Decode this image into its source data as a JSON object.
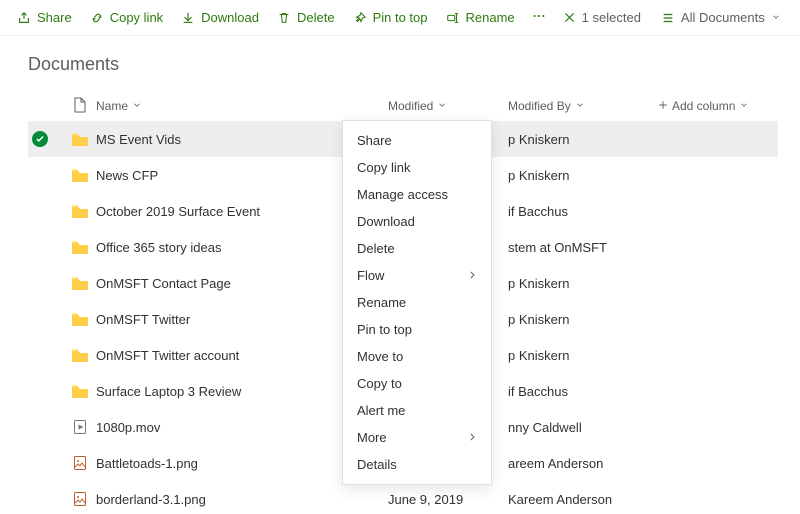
{
  "toolbar": {
    "share": "Share",
    "copy_link": "Copy link",
    "download": "Download",
    "delete": "Delete",
    "pin": "Pin to top",
    "rename": "Rename",
    "selected": "1 selected",
    "view": "All Documents"
  },
  "page": {
    "title": "Documents"
  },
  "columns": {
    "name": "Name",
    "modified": "Modified",
    "modified_by": "Modified By",
    "add": "Add column"
  },
  "rows": [
    {
      "type": "folder",
      "name": "MS Event Vids",
      "modified": "",
      "by": "p Kniskern",
      "selected": true
    },
    {
      "type": "folder",
      "name": "News CFP",
      "modified": "",
      "by": "p Kniskern"
    },
    {
      "type": "folder",
      "name": "October 2019 Surface Event",
      "modified": "",
      "by": "if Bacchus"
    },
    {
      "type": "folder",
      "name": "Office 365 story ideas",
      "modified": "",
      "by": "stem at OnMSFT"
    },
    {
      "type": "folder",
      "name": "OnMSFT Contact Page",
      "modified": "",
      "by": "p Kniskern"
    },
    {
      "type": "folder",
      "name": "OnMSFT Twitter",
      "modified": "",
      "by": "p Kniskern"
    },
    {
      "type": "folder",
      "name": "OnMSFT Twitter account",
      "modified": "",
      "by": "p Kniskern"
    },
    {
      "type": "folder",
      "name": "Surface Laptop 3 Review",
      "modified": "",
      "by": "if Bacchus"
    },
    {
      "type": "video",
      "name": "1080p.mov",
      "modified": "",
      "by": "nny Caldwell"
    },
    {
      "type": "image",
      "name": "Battletoads-1.png",
      "modified": "",
      "by": "areem Anderson"
    },
    {
      "type": "image",
      "name": "borderland-3.1.png",
      "modified": "June 9, 2019",
      "by": "Kareem Anderson"
    }
  ],
  "ctx": {
    "items": [
      {
        "label": "Share"
      },
      {
        "label": "Copy link"
      },
      {
        "label": "Manage access"
      },
      {
        "label": "Download"
      },
      {
        "label": "Delete"
      },
      {
        "label": "Flow",
        "sub": true
      },
      {
        "label": "Rename"
      },
      {
        "label": "Pin to top"
      },
      {
        "label": "Move to"
      },
      {
        "label": "Copy to"
      },
      {
        "label": "Alert me"
      },
      {
        "label": "More",
        "sub": true
      },
      {
        "label": "Details"
      }
    ]
  }
}
